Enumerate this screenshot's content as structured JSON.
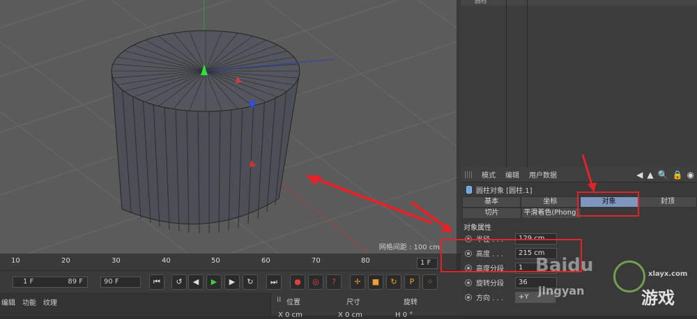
{
  "viewport": {
    "grid_spacing_label": "网格间距 : 100 cm"
  },
  "attributes": {
    "menu": [
      "模式",
      "编辑",
      "用户数据"
    ],
    "toolbar_icons": [
      "◀",
      "▲",
      "🔍",
      "🔒",
      "◉"
    ],
    "object_title": "圆柱对象 [圆柱.1]",
    "tabs_row1": [
      "基本",
      "坐标",
      "对象",
      "封顶"
    ],
    "tabs_row2": [
      "切片",
      "平滑着色(Phong)"
    ],
    "active_tab": "对象",
    "section_title": "对象属性",
    "properties": [
      {
        "label": "半径 . . .",
        "value": "129 cm"
      },
      {
        "label": "高度 . . .",
        "value": "215 cm"
      },
      {
        "label": "高度分段",
        "value": "1"
      },
      {
        "label": "旋转分段",
        "value": "36"
      },
      {
        "label": "方向 . . .",
        "value": "+Y"
      }
    ]
  },
  "timeline": {
    "ticks": [
      "10",
      "20",
      "30",
      "40",
      "50",
      "60",
      "70",
      "80"
    ],
    "current_frame": "1 F"
  },
  "transport": {
    "start_frame": "1 F",
    "end_frame": "89 F",
    "max_frame": "90 F"
  },
  "bottom_menu": [
    "编辑",
    "功能",
    "纹理"
  ],
  "coords_headers": [
    "位置",
    "尺寸",
    "旋转"
  ],
  "coords_values": [
    "X  0 cm",
    "X  0 cm",
    "H  0 °"
  ],
  "object_manager": {
    "first_item": "圆柱"
  },
  "watermark": {
    "baidu": "Baidu",
    "jingyan": "jingyan",
    "site": "xlayx.com",
    "game": "游戏"
  }
}
